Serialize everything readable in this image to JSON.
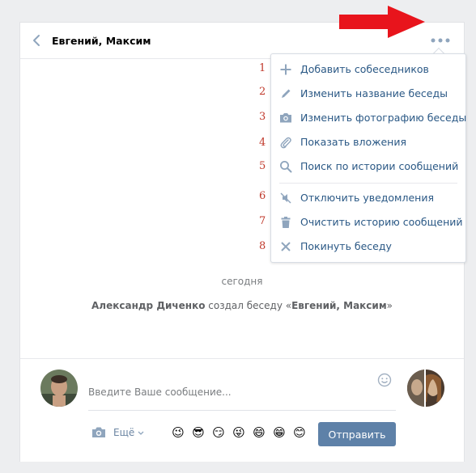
{
  "header": {
    "title": "Евгений, Максим"
  },
  "menu": {
    "items": [
      {
        "label": "Добавить собеседников",
        "icon": "plus-icon"
      },
      {
        "label": "Изменить название беседы",
        "icon": "pencil-icon"
      },
      {
        "label": "Изменить фотографию беседы",
        "icon": "camera-icon"
      },
      {
        "label": "Показать вложения",
        "icon": "paperclip-icon"
      },
      {
        "label": "Поиск по истории сообщений",
        "icon": "search-icon"
      },
      {
        "label": "Отключить уведомления",
        "icon": "mute-icon"
      },
      {
        "label": "Очистить историю сообщений",
        "icon": "trash-icon"
      },
      {
        "label": "Покинуть беседу",
        "icon": "close-icon"
      }
    ]
  },
  "annotations": [
    "1",
    "2",
    "3",
    "4",
    "5",
    "6",
    "7",
    "8"
  ],
  "chat": {
    "date_separator": "сегодня",
    "system_author": "Александр Диченко",
    "system_action": " создал беседу «",
    "system_chat_name": "Евгений, Максим",
    "system_end": "»"
  },
  "composer": {
    "placeholder": "Введите Ваше сообщение...",
    "more_label": "Ещё",
    "send_label": "Отправить",
    "emojis": [
      "😉",
      "😎",
      "😏",
      "😜",
      "😄",
      "😁",
      "😊"
    ]
  },
  "colors": {
    "accent": "#5e81a8",
    "link": "#2a5885",
    "annotation": "#c0392b",
    "arrow": "#e8141c"
  }
}
